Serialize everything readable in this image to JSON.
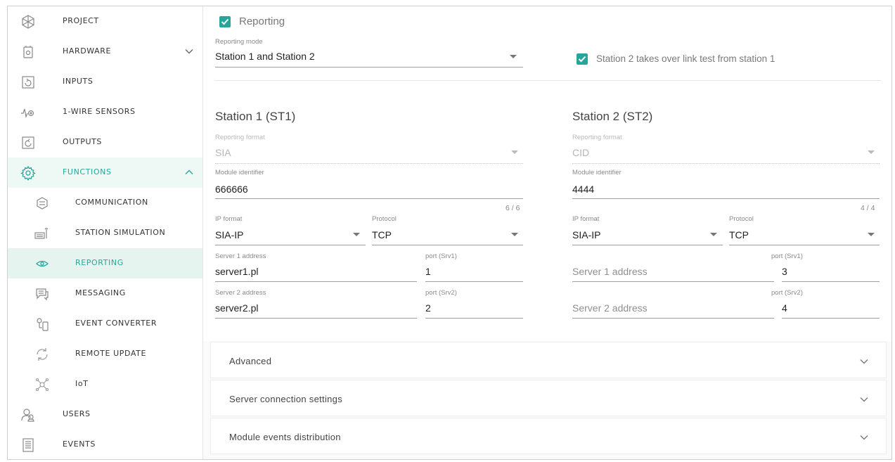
{
  "sidebar": {
    "items": [
      {
        "label": "PROJECT",
        "icon": "project-icon"
      },
      {
        "label": "HARDWARE",
        "icon": "hardware-icon"
      },
      {
        "label": "INPUTS",
        "icon": "inputs-icon"
      },
      {
        "label": "1-WIRE SENSORS",
        "icon": "sensor-icon"
      },
      {
        "label": "OUTPUTS",
        "icon": "outputs-icon"
      },
      {
        "label": "FUNCTIONS",
        "icon": "gear-icon"
      },
      {
        "label": "COMMUNICATION",
        "icon": "communication-icon"
      },
      {
        "label": "STATION SIMULATION",
        "icon": "station-simulation-icon"
      },
      {
        "label": "REPORTING",
        "icon": "eye-icon"
      },
      {
        "label": "MESSAGING",
        "icon": "messaging-icon"
      },
      {
        "label": "EVENT CONVERTER",
        "icon": "event-converter-icon"
      },
      {
        "label": "REMOTE UPDATE",
        "icon": "remote-update-icon"
      },
      {
        "label": "IoT",
        "icon": "iot-icon"
      },
      {
        "label": "USERS",
        "icon": "users-icon"
      },
      {
        "label": "EVENTS",
        "icon": "events-icon"
      }
    ],
    "accent_color": "#26a69a"
  },
  "reporting": {
    "checkbox_label": "Reporting",
    "checked": true,
    "mode_label": "Reporting mode",
    "mode_value": "Station 1 and Station 2",
    "takeover_label": "Station 2 takes over link test from station 1",
    "takeover_checked": true
  },
  "station1": {
    "title": "Station 1 (ST1)",
    "format_label": "Reporting format",
    "format_value": "SIA",
    "identifier_label": "Module identifier",
    "identifier_value": "666666",
    "identifier_counter": "6 / 6",
    "ip_format_label": "IP format",
    "ip_format_value": "SIA-IP",
    "protocol_label": "Protocol",
    "protocol_value": "TCP",
    "server1_label": "Server 1 address",
    "server1_value": "server1.pl",
    "port1_label": "port (Srv1)",
    "port1_value": "1",
    "server2_label": "Server 2 address",
    "server2_value": "server2.pl",
    "port2_label": "port (Srv2)",
    "port2_value": "2"
  },
  "station2": {
    "title": "Station 2 (ST2)",
    "format_label": "Reporting format",
    "format_value": "CID",
    "identifier_label": "Module identifier",
    "identifier_value": "4444",
    "identifier_counter": "4 / 4",
    "ip_format_label": "IP format",
    "ip_format_value": "SIA-IP",
    "protocol_label": "Protocol",
    "protocol_value": "TCP",
    "server1_placeholder": "Server 1 address",
    "port1_label": "port (Srv1)",
    "port1_value": "3",
    "server2_placeholder": "Server 2 address",
    "port2_label": "port (Srv2)",
    "port2_value": "4"
  },
  "accordions": [
    {
      "label": "Advanced"
    },
    {
      "label": "Server connection settings"
    },
    {
      "label": "Module events distribution"
    }
  ]
}
